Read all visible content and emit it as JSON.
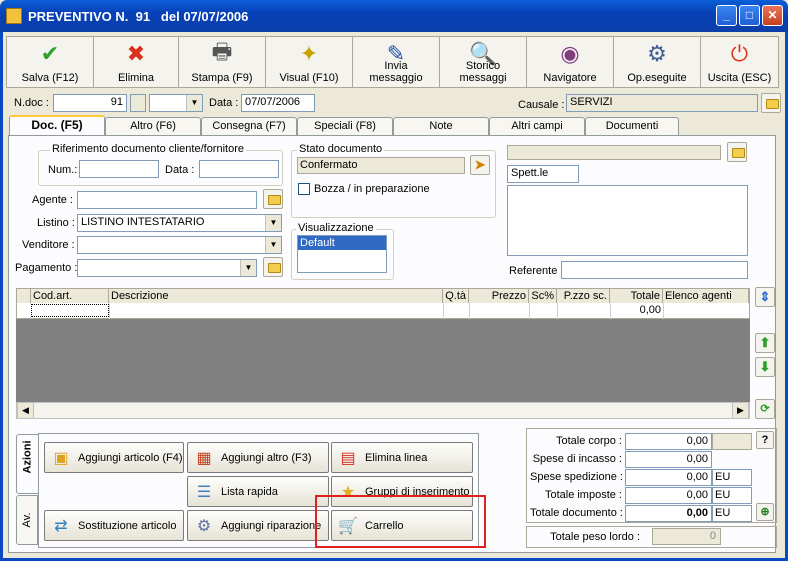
{
  "window": {
    "title": "PREVENTIVO N.  91   del 07/07/2006",
    "min": "_",
    "max": "□",
    "close": "✕"
  },
  "toolbar": [
    {
      "id": "save",
      "label": "Salva (F12)",
      "icon": "check-icon",
      "glyph": "✔",
      "color": "#2fa12a"
    },
    {
      "id": "delete",
      "label": "Elimina",
      "icon": "delete-x-icon",
      "glyph": "✖",
      "color": "#d8301c"
    },
    {
      "id": "print",
      "label": "Stampa (F9)",
      "icon": "printer-icon",
      "glyph": "🖶",
      "color": "#555"
    },
    {
      "id": "visual",
      "label": "Visual (F10)",
      "icon": "magic-wand-icon",
      "glyph": "✦",
      "color": "#c8a000"
    },
    {
      "id": "send",
      "label": "Invia\nmessaggio",
      "icon": "pen-paper-icon",
      "glyph": "✎",
      "color": "#2050a0"
    },
    {
      "id": "history",
      "label": "Storico\nmessaggi",
      "icon": "magnifier-icon",
      "glyph": "🔍",
      "color": "#3060a0"
    },
    {
      "id": "nav",
      "label": "Navigatore",
      "icon": "compass-icon",
      "glyph": "◉",
      "color": "#804080"
    },
    {
      "id": "ops",
      "label": "Op.eseguite",
      "icon": "gears-icon",
      "glyph": "⚙",
      "color": "#406090"
    },
    {
      "id": "exit",
      "label": "Uscita (ESC)",
      "icon": "power-icon",
      "glyph": "⏻",
      "color": "#e03820"
    }
  ],
  "header": {
    "ndoc_label": "N.doc :",
    "ndoc_value": "91",
    "data_label": "Data :",
    "data_value": "07/07/2006",
    "causale_label": "Causale :",
    "causale_value": "SERVIZI"
  },
  "tabs": [
    "Doc. (F5)",
    "Altro (F6)",
    "Consegna (F7)",
    "Speciali (F8)",
    "Note",
    "Altri campi",
    "Documenti"
  ],
  "ref": {
    "legend": "Riferimento documento cliente/fornitore",
    "num_label": "Num.:",
    "data_label": "Data :"
  },
  "stato": {
    "legend": "Stato documento",
    "value": "Confermato",
    "bozza_label": "Bozza / in preparazione"
  },
  "fields": {
    "agente_label": "Agente :",
    "listino_label": "Listino :",
    "listino_value": "LISTINO INTESTATARIO",
    "venditore_label": "Venditore :",
    "pagamento_label": "Pagamento :"
  },
  "visual": {
    "legend": "Visualizzazione",
    "selected": "Default"
  },
  "cliente": {
    "spett": "Spett.le",
    "referente_label": "Referente"
  },
  "grid": {
    "columns": [
      "Cod.art.",
      "Descrizione",
      "Q.tà",
      "Prezzo",
      "Sc%",
      "P.zzo sc.",
      "Totale",
      "Elenco agenti"
    ],
    "row_totale": "0,00"
  },
  "azioni": {
    "tab_azioni": "Azioni",
    "tab_av": "Av.",
    "buttons": [
      {
        "label": "Aggiungi articolo (F4)",
        "icon": "add-article-icon",
        "glyph": "▣"
      },
      {
        "label": "Aggiungi altro (F3)",
        "icon": "add-grid-icon",
        "glyph": "▦"
      },
      {
        "label": "Elimina linea",
        "icon": "delete-row-icon",
        "glyph": "▤"
      },
      {
        "label": "Lista rapida",
        "icon": "quick-list-icon",
        "glyph": "☰"
      },
      {
        "label": "Gruppi di inserimento",
        "icon": "star-group-icon",
        "glyph": "★"
      },
      {
        "label": "Sostituzione articolo",
        "icon": "replace-article-icon",
        "glyph": "⇄"
      },
      {
        "label": "Aggiungi riparazione",
        "icon": "repair-gear-icon",
        "glyph": "⚙"
      },
      {
        "label": "Carrello",
        "icon": "cart-icon",
        "glyph": "🛒"
      }
    ]
  },
  "totals": {
    "corpo_label": "Totale corpo :",
    "corpo": "0,00",
    "incasso_label": "Spese di incasso :",
    "incasso": "0,00",
    "spedizione_label": "Spese spedizione :",
    "spedizione": "0,00",
    "eu1": "EU",
    "imposte_label": "Totale imposte :",
    "imposte": "0,00",
    "eu2": "EU",
    "documento_label": "Totale documento :",
    "documento": "0,00",
    "eu3": "EU",
    "peso_label": "Totale peso lordo :",
    "peso": "0",
    "help": "?"
  },
  "highlight_color": "#e0201c"
}
